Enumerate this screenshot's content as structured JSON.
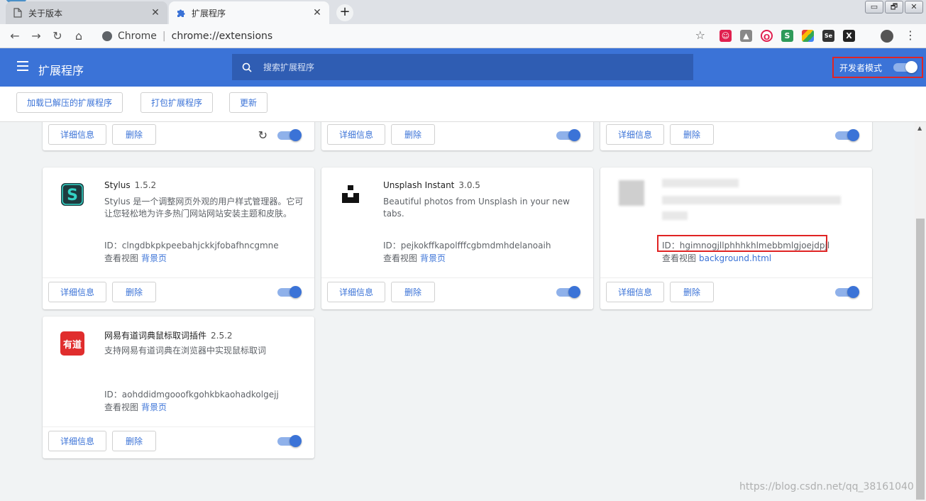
{
  "browser": {
    "tabs": [
      {
        "title": "关于版本",
        "active": false
      },
      {
        "title": "扩展程序",
        "active": true
      }
    ],
    "new_tab_symbol": "+",
    "omnibox": {
      "chip": "Chrome",
      "url": "chrome://extensions"
    },
    "window_controls": [
      "▭",
      "🗗",
      "✕"
    ]
  },
  "header": {
    "title": "扩展程序",
    "search_placeholder": "搜索扩展程序",
    "dev_mode_label": "开发者模式",
    "dev_mode_on": true,
    "accent": "#3b73d7"
  },
  "actions": {
    "load_unpacked": "加载已解压的扩展程序",
    "pack": "打包扩展程序",
    "update": "更新"
  },
  "common": {
    "details_label": "详细信息",
    "remove_label": "删除",
    "view_label": "查看视图",
    "background_page": "背景页"
  },
  "cards": [
    {
      "name": "Stylus",
      "version": "1.5.2",
      "description": "Stylus 是一个调整网页外观的用户样式管理器。它可让您轻松地为许多热门网站网站安装主题和皮肤。",
      "id_line": "ID：clngdbkpkpeebahjckkjfobafhncgmne",
      "view_link": "背景页",
      "enabled": true
    },
    {
      "name": "Unsplash Instant",
      "version": "3.0.5",
      "description": "Beautiful photos from Unsplash in your new tabs.",
      "id_line": "ID：pejkokffkapolfffcgbmdmhdelanoaih",
      "view_link": "背景页",
      "enabled": true
    },
    {
      "name": "",
      "version": "",
      "description": "",
      "id_line": "ID：hgimnogjllphhhkhlmebbmlgjoejdpjl",
      "view_link": "background.html",
      "enabled": true
    },
    {
      "name": "网易有道词典鼠标取词插件",
      "version": "2.5.2",
      "description": "支持网易有道词典在浏览器中实现鼠标取词",
      "id_line": "ID：aohddidmgooofkgohkbkaohadkolgejj",
      "view_link": "背景页",
      "enabled": true
    }
  ],
  "watermark": "https://blog.csdn.net/qq_38161040"
}
